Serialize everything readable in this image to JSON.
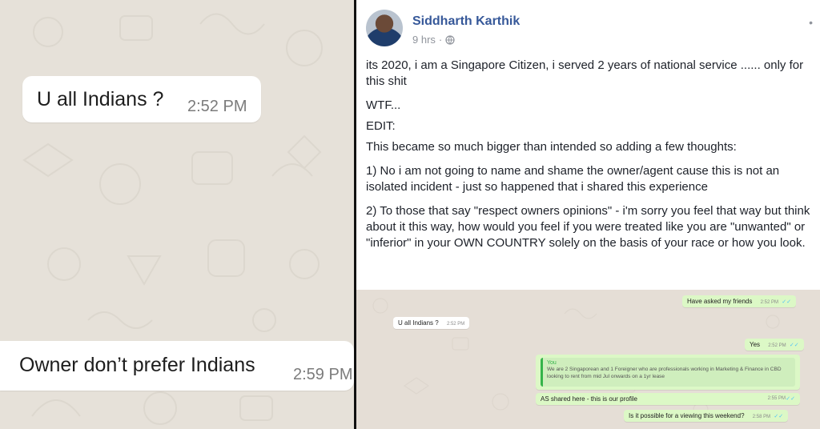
{
  "zoom_chat": {
    "messages": [
      {
        "text": "U all Indians ?",
        "time": "2:52 PM"
      },
      {
        "text": "Owner don’t prefer Indians",
        "time": "2:59 PM"
      }
    ]
  },
  "post": {
    "author": "Siddharth Karthik",
    "time_ago": "9 hrs",
    "paragraphs": [
      "its 2020, i am a Singapore Citizen, i served 2 years of national service ...... only for this shit",
      "WTF...",
      "EDIT:",
      "This became so much bigger than intended so adding a few thoughts:",
      "1) No i am not going to name and shame the owner/agent cause this is not an isolated incident - just so happened that i shared this experience",
      "2) To those that say \"respect owners opinions\" - i'm sorry you feel that way but think about it this way, how would you feel if you were treated like you are \"unwanted\" or \"inferior\" in your OWN COUNTRY solely on the basis of your race or how you look."
    ]
  },
  "small_chat": {
    "messages": [
      {
        "text": "Have asked my friends",
        "time": "2:52 PM"
      },
      {
        "text": "U all Indians ?",
        "time": "2:52 PM"
      },
      {
        "text": "Yes",
        "time": "2:52 PM"
      },
      {
        "quote_author": "You",
        "quote_text": "We are 2 Singaporean and 1 Foreigner who are professionals working in Marketing & Finance in CBD looking to rent from mid Jul onwards on a 1yr lease"
      },
      {
        "text": "AS shared here - this is our profile",
        "time": "2:55 PM"
      },
      {
        "text": "Is it possible for a viewing this weekend?",
        "time": "2:58 PM"
      }
    ]
  },
  "colors": {
    "author_link": "#365899",
    "outgoing_bubble": "#dcf8c6",
    "chat_background": "#e6e1d9",
    "read_tick": "#4fc3f7"
  }
}
